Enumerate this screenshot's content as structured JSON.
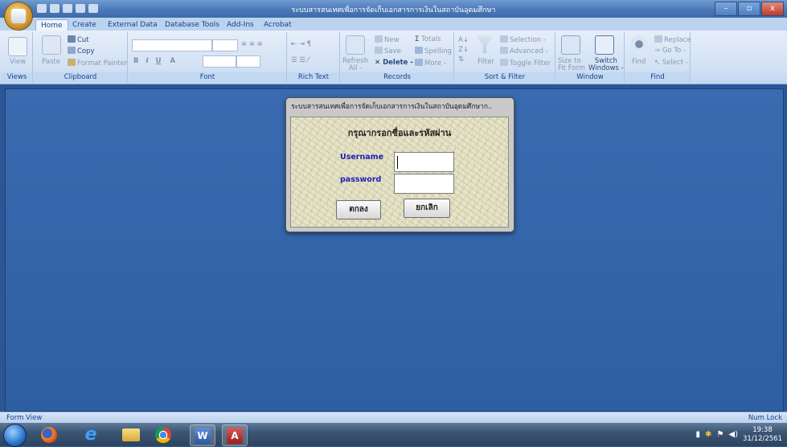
{
  "window": {
    "title": "ระบบสารสนเทศเพื่อการจัดเก็บเอกสารการเงินในสถาบันอุดมศึกษา",
    "controls": [
      "–",
      "▫",
      "x"
    ]
  },
  "ribbon": {
    "tabs": [
      "Home",
      "Create",
      "External Data",
      "Database Tools",
      "Add-Ins",
      "Acrobat"
    ],
    "active_tab": "Home",
    "groups": {
      "views": {
        "label": "Views",
        "view": "View"
      },
      "clipboard": {
        "label": "Clipboard",
        "paste": "Paste",
        "cut": "Cut",
        "copy": "Copy",
        "format_painter": "Format Painter"
      },
      "font": {
        "label": "Font",
        "bold": "B",
        "italic": "I",
        "underline": "U",
        "font_color": "A"
      },
      "rich_text": {
        "label": "Rich Text"
      },
      "records": {
        "label": "Records",
        "refresh": "Refresh",
        "refresh_sub": "All -",
        "new": "New",
        "save": "Save",
        "delete": "Delete -",
        "totals": "Totals",
        "spelling": "Spelling",
        "more": "More -"
      },
      "sort_filter": {
        "label": "Sort & Filter",
        "filter": "Filter",
        "selection": "Selection -",
        "advanced": "Advanced -",
        "toggle_filter": "Toggle Filter"
      },
      "window": {
        "label": "Window",
        "size_to_fit": "Size to",
        "size_to_fit_2": "Fit Form",
        "switch_windows": "Switch",
        "switch_windows_2": "Windows -"
      },
      "find": {
        "label": "Find",
        "find": "Find",
        "replace": "Replace",
        "go_to": "Go To -",
        "select": "Select -"
      }
    }
  },
  "dialog": {
    "title": "ระบบสารสนเทศเพื่อการจัดเก็บเอกสารการเงินในสถาบันอุดมศึกษาก..",
    "heading": "กรุณากรอกชื่อและรหัสผ่าน",
    "username_label": "Username",
    "username_value": "",
    "password_label": "password",
    "password_value": "",
    "ok_button": "ตกลง",
    "cancel_button": "ยกเลิก"
  },
  "status_bar": {
    "left": "Form View",
    "right": "Num Lock"
  },
  "taskbar": {
    "apps": [
      "start-orb",
      "firefox-icon",
      "internet-explorer-icon",
      "file-explorer-icon",
      "chrome-icon",
      "word-icon",
      "access-icon"
    ],
    "time": "19:38",
    "date": "31/12/2561"
  },
  "colors": {
    "workspace": "#2e5fa3",
    "label_blue": "#1f22b5",
    "dialog_bg": "#e6e3c6"
  }
}
